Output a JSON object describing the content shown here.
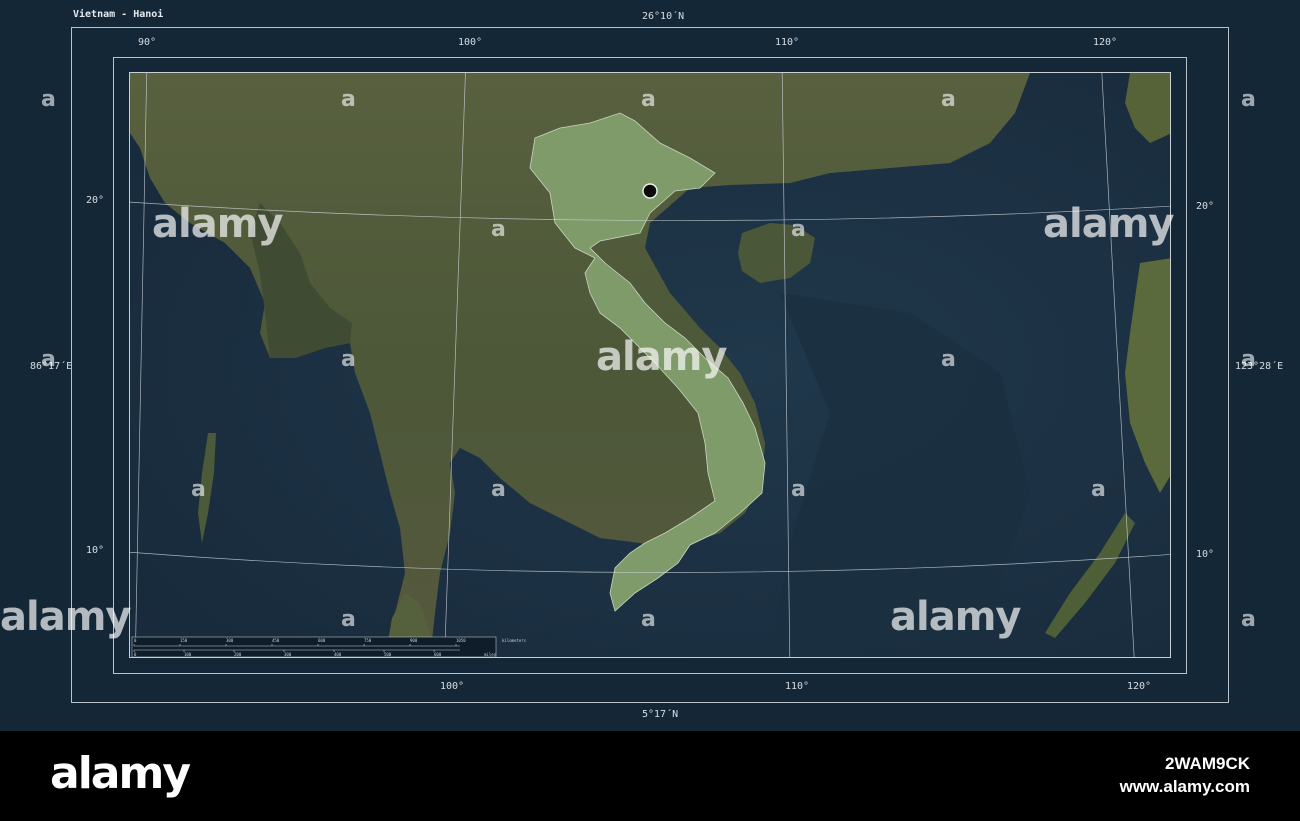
{
  "map": {
    "title": "Vietnam - Hanoi",
    "lat_top": "26°10´N",
    "lat_bottom": "5°17´N",
    "lon_left": "86°17´E",
    "lon_right": "123°28´E",
    "top_lon_labels": [
      "90°",
      "100°",
      "110°",
      "120°"
    ],
    "bottom_lon_labels": [
      "100°",
      "110°",
      "120°"
    ],
    "left_lat_labels": [
      "20°",
      "10°"
    ],
    "right_lat_labels": [
      "20°",
      "10°"
    ],
    "capital_marker": "Hanoi",
    "scale_bar": {
      "km_labels": [
        "0",
        "150",
        "300",
        "450",
        "600",
        "750",
        "900",
        "1050",
        "kilometers"
      ],
      "mi_labels": [
        "0",
        "100",
        "200",
        "300",
        "400",
        "500",
        "600",
        "miles"
      ]
    },
    "colors": {
      "sea": "#1e3446",
      "land": "#4f5a39",
      "highlight": "#7f9b69",
      "frame": "#132737"
    }
  },
  "watermark": {
    "brand": "alamy",
    "small_mark": "a"
  },
  "footer": {
    "brand": "alamy",
    "image_id": "2WAM9CK",
    "url": "www.alamy.com"
  }
}
